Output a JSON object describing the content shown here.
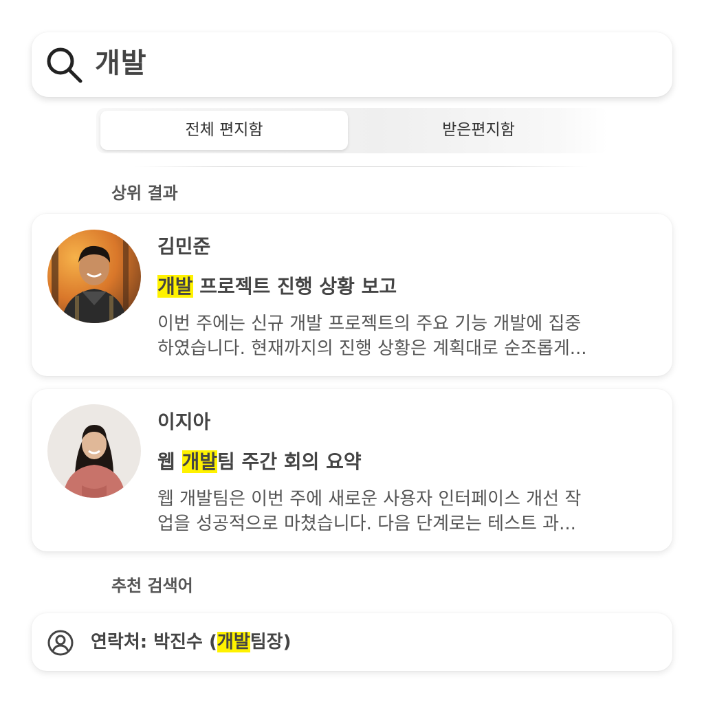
{
  "search": {
    "query": "개발"
  },
  "mailbox_tabs": [
    {
      "label": "전체 편지함",
      "selected": true
    },
    {
      "label": "받은편지함",
      "selected": false
    }
  ],
  "sections": {
    "top_results": "상위 결과",
    "suggestions": "추천 검색어"
  },
  "results": [
    {
      "sender": "김민준",
      "subject_highlight": "개발",
      "subject_rest": " 프로젝트 진행 상황 보고",
      "preview_line1": "이번 주에는 신규 개발 프로젝트의 주요 기능 개발에 집중",
      "preview_line2": "하였습니다. 현재까지의 진행 상황은 계획대로 순조롭게..."
    },
    {
      "sender": "이지아",
      "subject_pre": "웹 ",
      "subject_highlight": "개발",
      "subject_post": "팀 주간 회의 요약",
      "preview_line1": "웹 개발팀은 이번 주에 새로운 사용자 인터페이스 개선 작",
      "preview_line2": "업을 성공적으로 마쳤습니다. 다음 단계로는 테스트 과..."
    }
  ],
  "suggestion": {
    "prefix": "연락처: 박진수 (",
    "highlight": "개발",
    "suffix": "팀장)"
  },
  "colors": {
    "highlight": "#fff200",
    "background": "#ffffff"
  }
}
